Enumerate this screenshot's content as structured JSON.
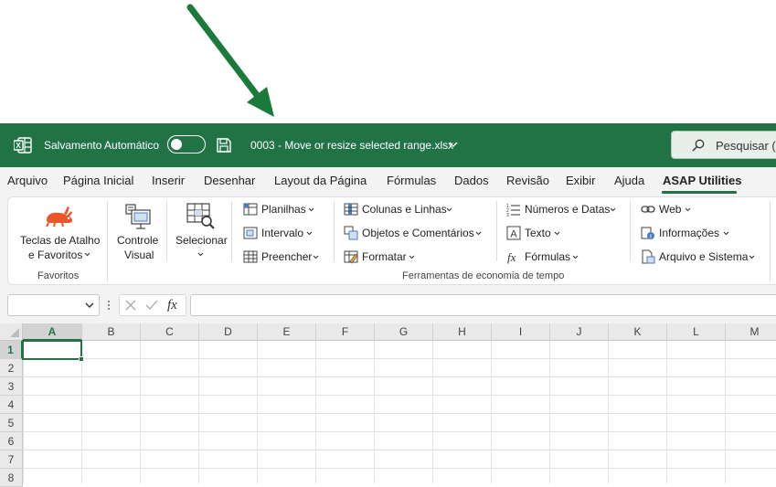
{
  "titlebar": {
    "autosave_label": "Salvamento Automático",
    "autosave_state": "off",
    "file_name": "0003 - Move or resize selected range.xlsx",
    "search_label": "Pesquisar (A",
    "bg_color": "#217346"
  },
  "tabs": [
    {
      "label": "Arquivo"
    },
    {
      "label": "Página Inicial"
    },
    {
      "label": "Inserir"
    },
    {
      "label": "Desenhar"
    },
    {
      "label": "Layout da Página"
    },
    {
      "label": "Fórmulas"
    },
    {
      "label": "Dados"
    },
    {
      "label": "Revisão"
    },
    {
      "label": "Exibir"
    },
    {
      "label": "Ajuda"
    },
    {
      "label": "ASAP Utilities"
    }
  ],
  "active_tab": "ASAP Utilities",
  "ribbon": {
    "favoritos": {
      "btn_line1": "Teclas de Atalho",
      "btn_line2": "e Favoritos",
      "group_label": "Favoritos"
    },
    "controle_line1": "Controle",
    "controle_line2": "Visual",
    "selecionar": "Selecionar",
    "col1": [
      "Planilhas",
      "Intervalo",
      "Preencher"
    ],
    "col2": [
      "Colunas e Linhas",
      "Objetos e Comentários",
      "Formatar"
    ],
    "col3": [
      "Números e Datas",
      "Texto",
      "Fórmulas"
    ],
    "col4": [
      "Web",
      "Informações",
      "Arquivo e Sistema"
    ],
    "group2_label": "Ferramentas de economia de tempo"
  },
  "formula_bar": {
    "name_box_value": "",
    "fx_label": "fx",
    "formula_value": ""
  },
  "grid": {
    "columns": [
      "A",
      "B",
      "C",
      "D",
      "E",
      "F",
      "G",
      "H",
      "I",
      "J",
      "K",
      "L",
      "M"
    ],
    "rows": [
      "1",
      "2",
      "3",
      "4",
      "5",
      "6",
      "7",
      "8"
    ],
    "active_cell": "A1"
  },
  "colors": {
    "accent": "#217346",
    "arrow": "#1a7a3c"
  }
}
